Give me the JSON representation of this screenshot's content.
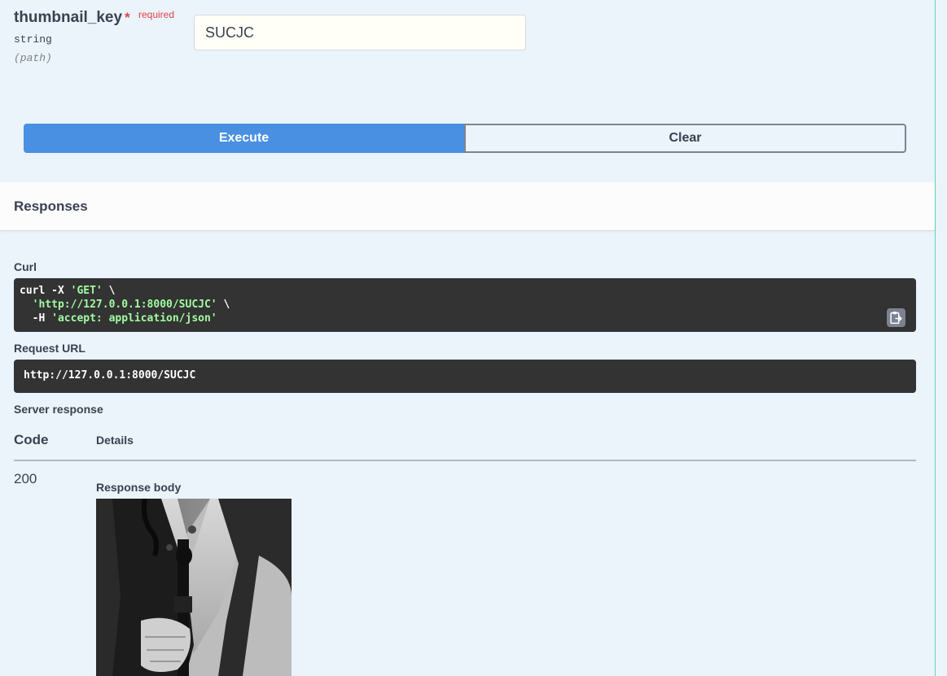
{
  "parameter": {
    "name": "thumbnail_key",
    "required_star": "*",
    "required_label": "required",
    "type": "string",
    "location": "(path)",
    "value": "SUCJC"
  },
  "buttons": {
    "execute": "Execute",
    "clear": "Clear"
  },
  "responses": {
    "title": "Responses",
    "curl_label": "Curl",
    "curl": {
      "line1_cmd": "curl -X ",
      "line1_method": "'GET'",
      "line1_end": " \\",
      "line2_indent": "  ",
      "line2_url": "'http://127.0.0.1:8000/SUCJC'",
      "line2_end": " \\",
      "line3_flag": "  -H ",
      "line3_header": "'accept: application/json'"
    },
    "copy_icon": "clipboard-copy-icon",
    "request_url_label": "Request URL",
    "request_url": "http://127.0.0.1:8000/SUCJC",
    "server_response_label": "Server response",
    "table": {
      "code_header": "Code",
      "details_header": "Details"
    },
    "response": {
      "code": "200",
      "body_label": "Response body",
      "image_description_icon": "photo-image"
    }
  },
  "colors": {
    "background": "#ebf3fb",
    "execute": "#4990e2",
    "code_bg": "#333333",
    "code_string": "#a2fca2",
    "required": "#e04444"
  }
}
